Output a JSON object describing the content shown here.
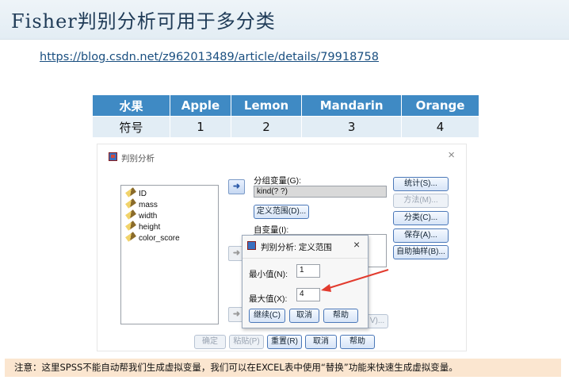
{
  "slide": {
    "title": "Fisher判别分析可用于多分类",
    "link": "https://blog.csdn.net/z962013489/article/details/79918758",
    "note": "注意：这里SPSS不能自动帮我们生成虚拟变量，我们可以在EXCEL表中使用“替换”功能来快速生成虚拟变量。"
  },
  "table": {
    "header": [
      "水果",
      "Apple",
      "Lemon",
      "Mandarin",
      "Orange"
    ],
    "row": [
      "符号",
      "1",
      "2",
      "3",
      "4"
    ]
  },
  "dialog": {
    "title": "判别分析",
    "close": "×",
    "variables": [
      "ID",
      "mass",
      "width",
      "height",
      "color_score"
    ],
    "grouping_label": "分组变量(G):",
    "grouping_value": "kind(? ?)",
    "define_range": "定义范围(D)...",
    "independents_label": "自变量(I):",
    "side_buttons": {
      "stats": "统计(S)...",
      "method": "方法(M)...",
      "classify": "分类(C)...",
      "save": "保存(A)...",
      "bootstrap": "自助抽样(B)..."
    },
    "bottom_buttons": {
      "ok": "确定",
      "paste": "粘贴(P)",
      "reset": "重置(R)",
      "cancel": "取消",
      "help": "帮助"
    },
    "partial_button": "V)...",
    "subdialog": {
      "title": "判别分析: 定义范围",
      "close": "×",
      "min_label": "最小值(N):",
      "min_value": "1",
      "max_label": "最大值(X):",
      "max_value": "4",
      "continue": "继续(C)",
      "cancel": "取消",
      "help": "帮助"
    }
  },
  "colors": {
    "table_header": "#3f8ac4",
    "table_body": "#e2edf5",
    "note_bg": "#fbe6d0",
    "annotation_arrow": "#e23b2e"
  }
}
